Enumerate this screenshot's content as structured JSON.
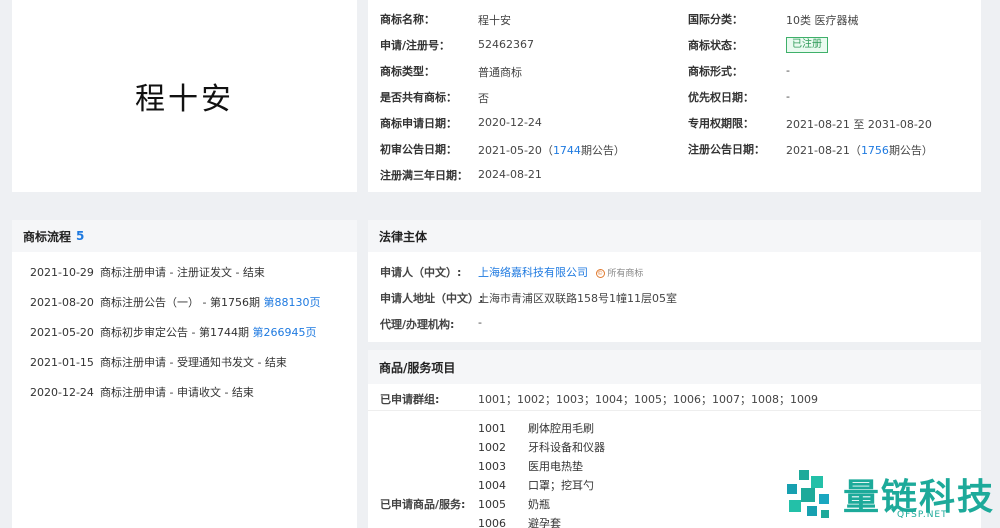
{
  "trademark": {
    "display_name": "程十安",
    "fields": {
      "name_label": "商标名称：",
      "name_value": "程十安",
      "intl_class_label": "国际分类：",
      "intl_class_value": "10类 医疗器械",
      "reg_no_label": "申请/注册号：",
      "reg_no_value": "52462367",
      "status_label": "商标状态：",
      "status_value": "已注册",
      "type_label": "商标类型：",
      "type_value": "普通商标",
      "form_label": "商标形式：",
      "form_value": "-",
      "shared_label": "是否共有商标：",
      "shared_value": "否",
      "priority_label": "优先权日期：",
      "priority_value": "-",
      "apply_date_label": "商标申请日期：",
      "apply_date_value": "2020-12-24",
      "exclusive_label": "专用权期限：",
      "exclusive_value": "2021-08-21 至 2031-08-20",
      "prelim_label": "初审公告日期：",
      "prelim_date": "2021-05-20（",
      "prelim_issue": "1744",
      "prelim_suffix": "期公告）",
      "reg_pub_label": "注册公告日期：",
      "reg_pub_date": "2021-08-21（",
      "reg_pub_issue": "1756",
      "reg_pub_suffix": "期公告）",
      "three_year_label": "注册满三年日期：",
      "three_year_value": "2024-08-21"
    }
  },
  "flow": {
    "title": "商标流程",
    "count": "5",
    "items": [
      {
        "date": "2021-10-29",
        "text": "商标注册申请 - 注册证发文 - 结束",
        "link": ""
      },
      {
        "date": "2021-08-20",
        "text": "商标注册公告（一） - 第1756期 ",
        "link": "第88130页"
      },
      {
        "date": "2021-05-20",
        "text": "商标初步审定公告 - 第1744期 ",
        "link": "第266945页"
      },
      {
        "date": "2021-01-15",
        "text": "商标注册申请 - 受理通知书发文 - 结束",
        "link": ""
      },
      {
        "date": "2020-12-24",
        "text": "商标注册申请 - 申请收文 - 结束",
        "link": ""
      }
    ]
  },
  "legal": {
    "title": "法律主体",
    "applicant_label": "申请人（中文）:",
    "applicant_value": "上海络嘉科技有限公司",
    "owner_tag": "所有商标",
    "address_label": "申请人地址（中文）:",
    "address_value": "上海市青浦区双联路158号1幢11层05室",
    "agent_label": "代理/办理机构:",
    "agent_value": "-"
  },
  "goods": {
    "title": "商品/服务项目",
    "groups_label": "已申请群组:",
    "groups_value": "1001；1002；1003；1004；1005；1006；1007；1008；1009",
    "items_label": "已申请商品/服务:",
    "items": [
      {
        "code": "1001",
        "name": "刷体腔用毛刷"
      },
      {
        "code": "1002",
        "name": "牙科设备和仪器"
      },
      {
        "code": "1003",
        "name": "医用电热垫"
      },
      {
        "code": "1004",
        "name": "口罩；挖耳勺"
      },
      {
        "code": "1005",
        "name": "奶瓶"
      },
      {
        "code": "1006",
        "name": "避孕套"
      }
    ]
  },
  "watermark": {
    "text": "量链科技",
    "sub": "QFSP.NET",
    "color": "#1daa9a"
  }
}
